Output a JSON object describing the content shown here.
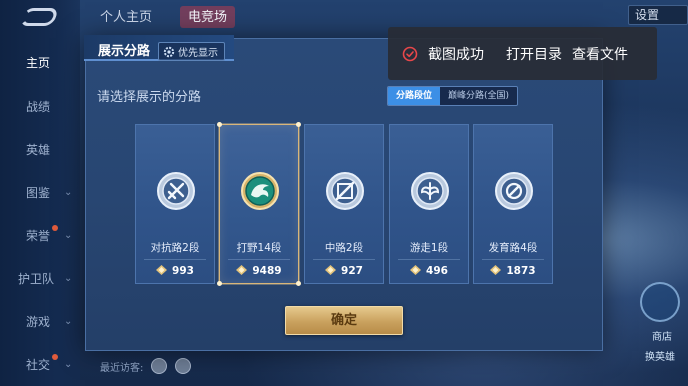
{
  "background": {
    "sidebar_items": [
      {
        "label": "主页",
        "active": true
      },
      {
        "label": "战绩"
      },
      {
        "label": "英雄"
      },
      {
        "label": "图鉴"
      },
      {
        "label": "荣誉"
      },
      {
        "label": "护卫队"
      },
      {
        "label": "游戏"
      },
      {
        "label": "社交"
      }
    ],
    "top_tabs": [
      "个人主页",
      "电竞场"
    ],
    "settings_label": "设置",
    "visitors_label": "最近访客:",
    "round_buttons": [
      "商店",
      "换英雄"
    ]
  },
  "modal": {
    "tab_title": "展示分路",
    "priority_label": "优先显示",
    "subtitle": "请选择展示的分路",
    "segments": [
      {
        "label": "分路段位",
        "active": true
      },
      {
        "label": "巅峰分路(全国)",
        "active": false
      }
    ],
    "cards": [
      {
        "name": "对抗路2段",
        "score": "993",
        "selected": false,
        "badge": "sword-badge-icon"
      },
      {
        "name": "打野14段",
        "score": "9489",
        "selected": true,
        "badge": "dragon-badge-icon"
      },
      {
        "name": "中路2段",
        "score": "927",
        "selected": false,
        "badge": "slash-badge-icon"
      },
      {
        "name": "游走1段",
        "score": "496",
        "selected": false,
        "badge": "wing-badge-icon"
      },
      {
        "name": "发育路4段",
        "score": "1873",
        "selected": false,
        "badge": "target-badge-icon"
      }
    ],
    "confirm_label": "确定"
  },
  "toast": {
    "message": "截图成功",
    "open_dir_label": "打开目录",
    "view_file_label": "查看文件"
  },
  "colors": {
    "accent_blue": "#3c8fe6",
    "gold": "#c9a15e",
    "toast_ok": "#e8474a"
  }
}
